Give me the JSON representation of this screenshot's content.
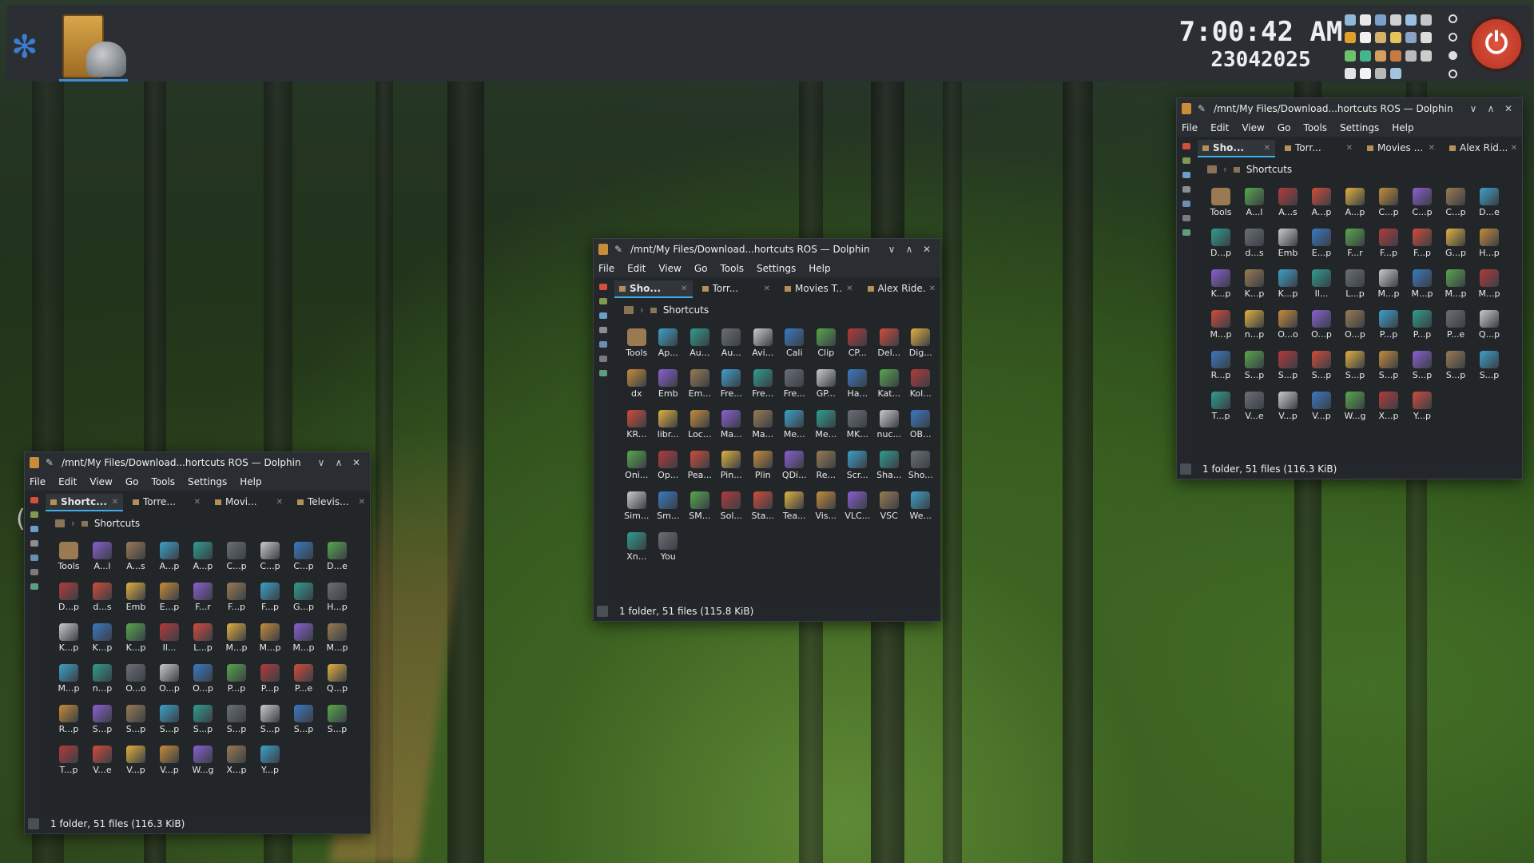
{
  "panel": {
    "clock_time": "7:00:42 AM",
    "clock_date": "23042025",
    "power_symbol": "⏻",
    "tray_colors": [
      "#8fb7d8",
      "#e8e8e8",
      "#7aa2c9",
      "#d0d0d0",
      "#9bc0e4",
      "#c7c7c7",
      "#e0a030",
      "#f0f0f0",
      "#d4b06a",
      "#e5c35a",
      "#8aa2c4",
      "#dcdcdc",
      "#6cc46a",
      "#47b58c",
      "#d49f5c",
      "#c97a3f",
      "#bbbbbb",
      "#cccccc",
      "#e4e4e4",
      "#f2f2f2",
      "#b9b9b9",
      "#a3c4e0"
    ]
  },
  "stray_text": "(",
  "windows": [
    {
      "title": "/mnt/My Files/Download...hortcuts ROS — Dolphin",
      "menu": [
        "File",
        "Edit",
        "View",
        "Go",
        "Tools",
        "Settings",
        "Help"
      ],
      "tabs": [
        "Sho...",
        "Torr...",
        "Movies T...",
        "Alex Ride..."
      ],
      "breadcrumb": "Shortcuts",
      "items": [
        "Tools",
        "Ap...",
        "Au...",
        "Au...",
        "Avi...",
        "Cali",
        "Clip",
        "CP...",
        "Del...",
        "Dig...",
        "dx",
        "Emb",
        "Em...",
        "Fre...",
        "Fre...",
        "Fre...",
        "GP...",
        "Ha...",
        "Kat...",
        "Kol...",
        "KR...",
        "libr...",
        "Loc...",
        "Ma...",
        "Ma...",
        "Me...",
        "Me...",
        "MK...",
        "nuc...",
        "OB...",
        "Oni...",
        "Op...",
        "Pea...",
        "Pin...",
        "Plin",
        "QDi...",
        "Re...",
        "Scr...",
        "Sha...",
        "Sho...",
        "Sim...",
        "Sm...",
        "SM...",
        "Sol...",
        "Sta...",
        "Tea...",
        "Vis...",
        "VLC...",
        "VSC",
        "We...",
        "Xn...",
        "You"
      ],
      "status": "1 folder, 51 files (115.8 KiB)"
    },
    {
      "title": "/mnt/My Files/Download...hortcuts ROS — Dolphin",
      "menu": [
        "File",
        "Edit",
        "View",
        "Go",
        "Tools",
        "Settings",
        "Help"
      ],
      "tabs": [
        "Sho...",
        "Torr...",
        "Movies ...",
        "Alex Rid..."
      ],
      "breadcrumb": "Shortcuts",
      "items": [
        "Tools",
        "A...l",
        "A...s",
        "A...p",
        "A...p",
        "C...p",
        "C...p",
        "C...p",
        "D...e",
        "D...p",
        "d...s",
        "Emb",
        "E...p",
        "F...r",
        "F...p",
        "F...p",
        "G...p",
        "H...p",
        "K...p",
        "K...p",
        "K...p",
        "Il...",
        "L...p",
        "M...p",
        "M...p",
        "M...p",
        "M...p",
        "M...p",
        "n...p",
        "O...o",
        "O...p",
        "O...p",
        "P...p",
        "P...p",
        "P...e",
        "Q...p",
        "R...p",
        "S...p",
        "S...p",
        "S...p",
        "S...p",
        "S...p",
        "S...p",
        "S...p",
        "S...p",
        "T...p",
        "V...e",
        "V...p",
        "V...p",
        "W...g",
        "X...p",
        "Y...p"
      ],
      "status": "1 folder, 51 files (116.3 KiB)"
    },
    {
      "title": "/mnt/My Files/Download...hortcuts ROS — Dolphin",
      "menu": [
        "File",
        "Edit",
        "View",
        "Go",
        "Tools",
        "Settings",
        "Help"
      ],
      "tabs": [
        "Shortc...",
        "Torre...",
        "Movi...",
        "Televis..."
      ],
      "breadcrumb": "Shortcuts",
      "items": [
        "Tools",
        "A...l",
        "A...s",
        "A...p",
        "A...p",
        "C...p",
        "C...p",
        "C...p",
        "D...e",
        "D...p",
        "d...s",
        "Emb",
        "E...p",
        "F...r",
        "F...p",
        "F...p",
        "G...p",
        "H...p",
        "K...p",
        "K...p",
        "K...p",
        "Il...",
        "L...p",
        "M...p",
        "M...p",
        "M...p",
        "M...p",
        "M...p",
        "n...p",
        "O...o",
        "O...p",
        "O...p",
        "P...p",
        "P...p",
        "P...e",
        "Q...p",
        "R...p",
        "S...p",
        "S...p",
        "S...p",
        "S...p",
        "S...p",
        "S...p",
        "S...p",
        "S...p",
        "T...p",
        "V...e",
        "V...p",
        "V...p",
        "W...g",
        "X...p",
        "Y...p"
      ],
      "status": "1 folder, 51 files (116.3 KiB)"
    }
  ],
  "icon_palette": [
    "#9a7a52",
    "#3a78c2",
    "#c58b3a",
    "#6b6f75",
    "#d14b3a",
    "#3da0c9",
    "#57a84c",
    "#8a5ed0",
    "#c9c9c9",
    "#e0b040",
    "#2f9c8e",
    "#b33a3a"
  ]
}
